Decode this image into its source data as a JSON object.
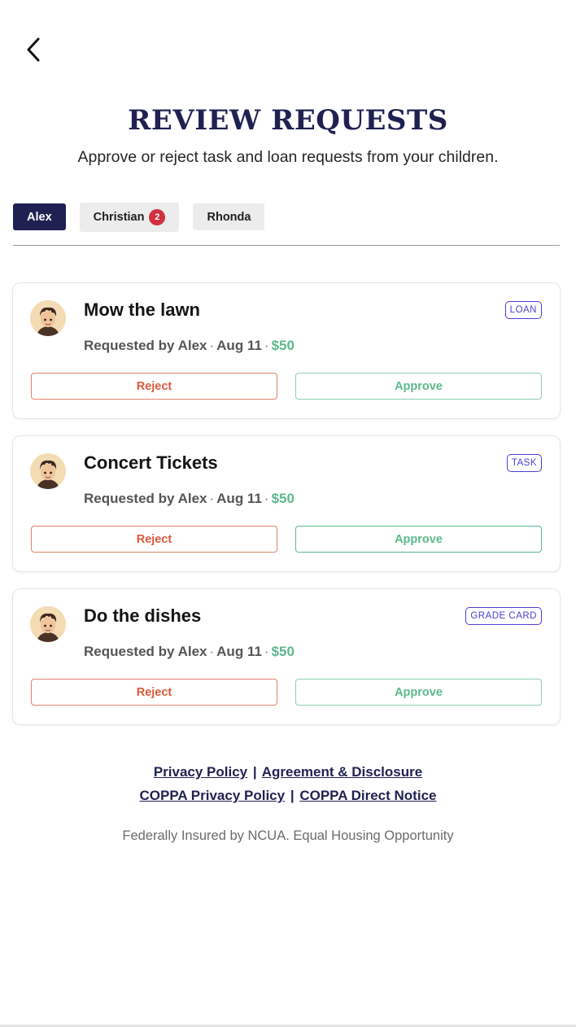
{
  "header": {
    "title": "REVIEW REQUESTS",
    "subtitle": "Approve or reject task and loan requests from your children."
  },
  "tabs": [
    {
      "label": "Alex",
      "active": true
    },
    {
      "label": "Christian",
      "badge": "2",
      "active": false
    },
    {
      "label": "Rhonda",
      "active": false
    }
  ],
  "requests": [
    {
      "title": "Mow the lawn",
      "tag": "LOAN",
      "requested_by": "Requested by Alex",
      "date": "Aug 11",
      "amount": "$50",
      "reject_label": "Reject",
      "approve_label": "Approve"
    },
    {
      "title": "Concert Tickets",
      "tag": "TASK",
      "requested_by": "Requested by Alex",
      "date": "Aug 11",
      "amount": "$50",
      "reject_label": "Reject",
      "approve_label": "Approve"
    },
    {
      "title": "Do the dishes",
      "tag": "GRADE CARD",
      "requested_by": "Requested by Alex",
      "date": "Aug 11",
      "amount": "$50",
      "reject_label": "Reject",
      "approve_label": "Approve"
    }
  ],
  "footer": {
    "links_row1": [
      "Privacy Policy",
      "Agreement & Disclosure"
    ],
    "links_row2": [
      "COPPA Privacy Policy",
      "COPPA Direct Notice"
    ],
    "separator": "|",
    "note": "Federally Insured by NCUA. Equal Housing Opportunity"
  },
  "colors": {
    "brand_navy": "#1f2152",
    "reject": "#db5a3c",
    "approve": "#5bb98a",
    "tag": "#4b3fd6",
    "badge": "#d0303f"
  },
  "icons": {
    "back": "chevron-left-icon",
    "avatar": "child-avatar"
  }
}
